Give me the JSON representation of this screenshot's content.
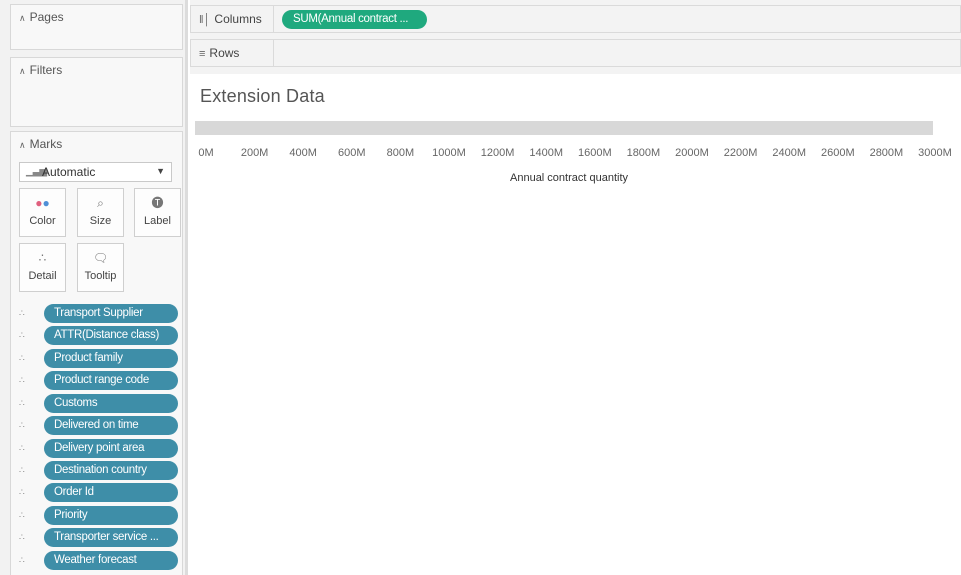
{
  "pages_card": {
    "title": "Pages",
    "icon": "caret-up-icon"
  },
  "filters_card": {
    "title": "Filters",
    "icon": "caret-up-icon"
  },
  "marks_card": {
    "title": "Marks",
    "mark_type": "Automatic",
    "buttons": {
      "color": "Color",
      "size": "Size",
      "label": "Label",
      "detail": "Detail",
      "tooltip": "Tooltip"
    },
    "fields": [
      "Transport Supplier",
      "ATTR(Distance class)",
      "Product family",
      "Product range code",
      "Customs",
      "Delivered on time",
      "Delivery point area",
      "Destination country",
      "Order Id",
      "Priority",
      "Transporter service ...",
      "Weather forecast"
    ]
  },
  "shelves": {
    "columns_label": "Columns",
    "columns_pill": "SUM(Annual contract ...",
    "rows_label": "Rows"
  },
  "view": {
    "title": "Extension Data",
    "axis_title": "Annual contract quantity",
    "tick_labels": [
      "0M",
      "200M",
      "400M",
      "600M",
      "800M",
      "1000M",
      "1200M",
      "1400M",
      "1600M",
      "1800M",
      "2000M",
      "2200M",
      "2400M",
      "2600M",
      "2800M",
      "3000M"
    ]
  },
  "colors": {
    "dimension_pill": "#3e8ea8",
    "measure_pill": "#1fa97e",
    "bar": "#d8d8d8"
  },
  "chart_data": {
    "type": "bar",
    "title": "Extension Data",
    "xlabel": "Annual contract quantity",
    "xlim": [
      0,
      3000
    ],
    "x_unit": "M",
    "categories": [
      ""
    ],
    "values": [
      2990
    ]
  }
}
